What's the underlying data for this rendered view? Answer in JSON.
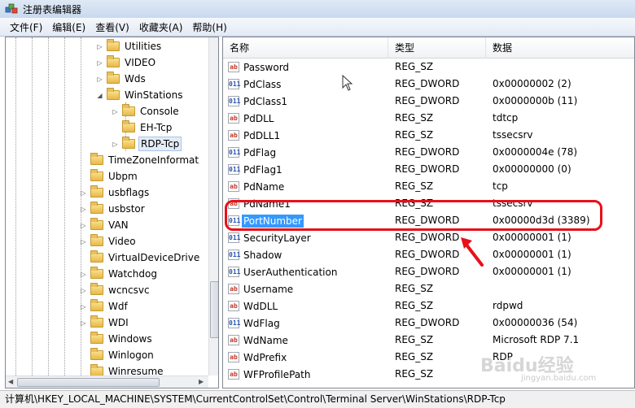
{
  "window": {
    "title": "注册表编辑器"
  },
  "menu": [
    "文件(F)",
    "编辑(E)",
    "查看(V)",
    "收藏夹(A)",
    "帮助(H)"
  ],
  "tree": [
    {
      "label": "Utilities",
      "expander": "▷",
      "level": 1
    },
    {
      "label": "VIDEO",
      "expander": "▷",
      "level": 1
    },
    {
      "label": "Wds",
      "expander": "▷",
      "level": 1
    },
    {
      "label": "WinStations",
      "expander": "◢",
      "level": 1
    },
    {
      "label": "Console",
      "expander": "▷",
      "level": 2
    },
    {
      "label": "EH-Tcp",
      "expander": "",
      "level": 2
    },
    {
      "label": "RDP-Tcp",
      "expander": "▷",
      "level": 2,
      "selected": true
    },
    {
      "label": "TimeZoneInformat",
      "expander": "",
      "level": 0
    },
    {
      "label": "Ubpm",
      "expander": "",
      "level": 0
    },
    {
      "label": "usbflags",
      "expander": "▷",
      "level": 0
    },
    {
      "label": "usbstor",
      "expander": "▷",
      "level": 0
    },
    {
      "label": "VAN",
      "expander": "▷",
      "level": 0
    },
    {
      "label": "Video",
      "expander": "▷",
      "level": 0
    },
    {
      "label": "VirtualDeviceDrive",
      "expander": "",
      "level": 0
    },
    {
      "label": "Watchdog",
      "expander": "▷",
      "level": 0
    },
    {
      "label": "wcncsvc",
      "expander": "▷",
      "level": 0
    },
    {
      "label": "Wdf",
      "expander": "▷",
      "level": 0
    },
    {
      "label": "WDI",
      "expander": "▷",
      "level": 0
    },
    {
      "label": "Windows",
      "expander": "",
      "level": 0
    },
    {
      "label": "Winlogon",
      "expander": "",
      "level": 0
    },
    {
      "label": "Winresume",
      "expander": "",
      "level": 0
    }
  ],
  "columns": {
    "name": "名称",
    "type": "类型",
    "data": "数据"
  },
  "values": [
    {
      "name": "Password",
      "type": "REG_SZ",
      "data": "",
      "icon": "sz"
    },
    {
      "name": "PdClass",
      "type": "REG_DWORD",
      "data": "0x00000002 (2)",
      "icon": "dword"
    },
    {
      "name": "PdClass1",
      "type": "REG_DWORD",
      "data": "0x0000000b (11)",
      "icon": "dword"
    },
    {
      "name": "PdDLL",
      "type": "REG_SZ",
      "data": "tdtcp",
      "icon": "sz"
    },
    {
      "name": "PdDLL1",
      "type": "REG_SZ",
      "data": "tssecsrv",
      "icon": "sz"
    },
    {
      "name": "PdFlag",
      "type": "REG_DWORD",
      "data": "0x0000004e (78)",
      "icon": "dword"
    },
    {
      "name": "PdFlag1",
      "type": "REG_DWORD",
      "data": "0x00000000 (0)",
      "icon": "dword"
    },
    {
      "name": "PdName",
      "type": "REG_SZ",
      "data": "tcp",
      "icon": "sz"
    },
    {
      "name": "PdName1",
      "type": "REG_SZ",
      "data": "tssecsrv",
      "icon": "sz"
    },
    {
      "name": "PortNumber",
      "type": "REG_DWORD",
      "data": "0x00000d3d (3389)",
      "icon": "dword",
      "highlight": true
    },
    {
      "name": "SecurityLayer",
      "type": "REG_DWORD",
      "data": "0x00000001 (1)",
      "icon": "dword"
    },
    {
      "name": "Shadow",
      "type": "REG_DWORD",
      "data": "0x00000001 (1)",
      "icon": "dword"
    },
    {
      "name": "UserAuthentication",
      "type": "REG_DWORD",
      "data": "0x00000001 (1)",
      "icon": "dword"
    },
    {
      "name": "Username",
      "type": "REG_SZ",
      "data": "",
      "icon": "sz"
    },
    {
      "name": "WdDLL",
      "type": "REG_SZ",
      "data": "rdpwd",
      "icon": "sz"
    },
    {
      "name": "WdFlag",
      "type": "REG_DWORD",
      "data": "0x00000036 (54)",
      "icon": "dword"
    },
    {
      "name": "WdName",
      "type": "REG_SZ",
      "data": "Microsoft RDP 7.1",
      "icon": "sz"
    },
    {
      "name": "WdPrefix",
      "type": "REG_SZ",
      "data": "RDP",
      "icon": "sz"
    },
    {
      "name": "WFProfilePath",
      "type": "REG_SZ",
      "data": "",
      "icon": "sz"
    }
  ],
  "icon_labels": {
    "sz": "ab",
    "dword": "011"
  },
  "status": "计算机\\HKEY_LOCAL_MACHINE\\SYSTEM\\CurrentControlSet\\Control\\Terminal Server\\WinStations\\RDP-Tcp",
  "watermark": {
    "logo": "Baidu经验",
    "url": "jingyan.baidu.com"
  },
  "colors": {
    "selection": "#3399ff",
    "annotation": "#e8101a"
  }
}
